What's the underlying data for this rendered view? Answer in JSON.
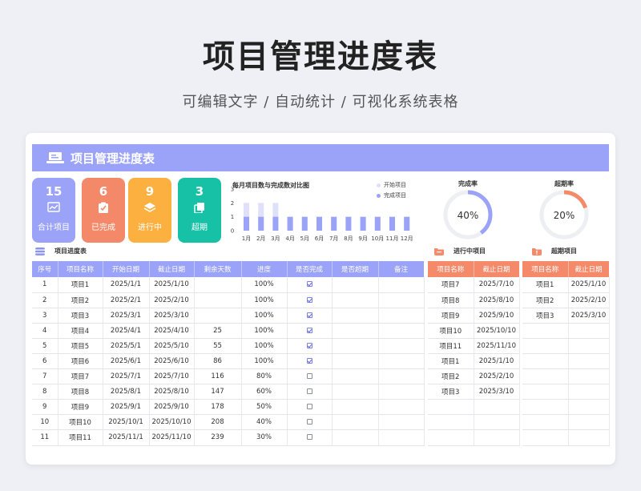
{
  "page": {
    "title": "项目管理进度表",
    "subtitle": "可编辑文字  /  自动统计  /  可视化系统表格"
  },
  "sheet": {
    "title": "项目管理进度表"
  },
  "kpis": [
    {
      "value": "15",
      "label": "合计项目",
      "color": "#9aa3f7",
      "icon": "chart-icon"
    },
    {
      "value": "6",
      "label": "已完成",
      "color": "#f4896a",
      "icon": "clipboard-check-icon"
    },
    {
      "value": "9",
      "label": "进行中",
      "color": "#fbb040",
      "icon": "layers-icon"
    },
    {
      "value": "3",
      "label": "超期",
      "color": "#16c1a6",
      "icon": "copy-icon"
    }
  ],
  "chart_data": {
    "type": "bar",
    "title": "每月项目数与完成数对比图",
    "categories": [
      "1月",
      "2月",
      "3月",
      "4月",
      "5月",
      "6月",
      "7月",
      "8月",
      "9月",
      "10月",
      "11月",
      "12月"
    ],
    "series": [
      {
        "name": "开始项目",
        "values": [
          2,
          2,
          2,
          1,
          1,
          1,
          1,
          1,
          1,
          1,
          1,
          1
        ],
        "color": "#dfe1fb"
      },
      {
        "name": "完成项目",
        "values": [
          1,
          1,
          1,
          1,
          1,
          1,
          1,
          1,
          1,
          1,
          1,
          1
        ],
        "color": "#9aa3f7"
      }
    ],
    "ylim": [
      0,
      3
    ],
    "yticks": [
      "3",
      "2",
      "1",
      "0"
    ]
  },
  "rates": [
    {
      "title": "完成率",
      "value": "40%",
      "fraction": 0.4,
      "color": "#9aa3f7"
    },
    {
      "title": "超期率",
      "value": "20%",
      "fraction": 0.2,
      "color": "#f48a6a"
    }
  ],
  "progress_table": {
    "label": "项目进度表",
    "headers": [
      "序号",
      "项目名称",
      "开始日期",
      "截止日期",
      "剩余天数",
      "进度",
      "是否完成",
      "是否超期",
      "备注"
    ],
    "rows": [
      {
        "no": "1",
        "name": "项目1",
        "start": "2025/1/1",
        "end": "2025/1/10",
        "remain": "",
        "progress": "100%",
        "done": true
      },
      {
        "no": "2",
        "name": "项目2",
        "start": "2025/2/1",
        "end": "2025/2/10",
        "remain": "",
        "progress": "100%",
        "done": true
      },
      {
        "no": "3",
        "name": "项目3",
        "start": "2025/3/1",
        "end": "2025/3/10",
        "remain": "",
        "progress": "100%",
        "done": true
      },
      {
        "no": "4",
        "name": "项目4",
        "start": "2025/4/1",
        "end": "2025/4/10",
        "remain": "25",
        "progress": "100%",
        "done": true
      },
      {
        "no": "5",
        "name": "项目5",
        "start": "2025/5/1",
        "end": "2025/5/10",
        "remain": "55",
        "progress": "100%",
        "done": true
      },
      {
        "no": "6",
        "name": "项目6",
        "start": "2025/6/1",
        "end": "2025/6/10",
        "remain": "86",
        "progress": "100%",
        "done": true
      },
      {
        "no": "7",
        "name": "项目7",
        "start": "2025/7/1",
        "end": "2025/7/10",
        "remain": "116",
        "progress": "80%",
        "done": false
      },
      {
        "no": "8",
        "name": "项目8",
        "start": "2025/8/1",
        "end": "2025/8/10",
        "remain": "147",
        "progress": "60%",
        "done": false
      },
      {
        "no": "9",
        "name": "项目9",
        "start": "2025/9/1",
        "end": "2025/9/10",
        "remain": "178",
        "progress": "50%",
        "done": false
      },
      {
        "no": "10",
        "name": "项目10",
        "start": "2025/10/1",
        "end": "2025/10/10",
        "remain": "208",
        "progress": "40%",
        "done": false
      },
      {
        "no": "11",
        "name": "项目11",
        "start": "2025/11/1",
        "end": "2025/11/10",
        "remain": "239",
        "progress": "30%",
        "done": false
      }
    ]
  },
  "in_progress_table": {
    "label": "进行中项目",
    "headers": [
      "项目名称",
      "截止日期"
    ],
    "rows": [
      [
        "项目7",
        "2025/7/10"
      ],
      [
        "项目8",
        "2025/8/10"
      ],
      [
        "项目9",
        "2025/9/10"
      ],
      [
        "项目10",
        "2025/10/10"
      ],
      [
        "项目11",
        "2025/11/10"
      ],
      [
        "项目1",
        "2025/1/10"
      ],
      [
        "项目2",
        "2025/2/10"
      ],
      [
        "项目3",
        "2025/3/10"
      ],
      [
        "",
        ""
      ],
      [
        "",
        ""
      ],
      [
        "",
        ""
      ]
    ]
  },
  "overdue_table": {
    "label": "超期项目",
    "headers": [
      "项目名称",
      "截止日期"
    ],
    "rows": [
      [
        "项目1",
        "2025/1/10"
      ],
      [
        "项目2",
        "2025/2/10"
      ],
      [
        "项目3",
        "2025/3/10"
      ],
      [
        "",
        ""
      ],
      [
        "",
        ""
      ],
      [
        "",
        ""
      ],
      [
        "",
        ""
      ],
      [
        "",
        ""
      ],
      [
        "",
        ""
      ],
      [
        "",
        ""
      ],
      [
        "",
        ""
      ]
    ]
  }
}
